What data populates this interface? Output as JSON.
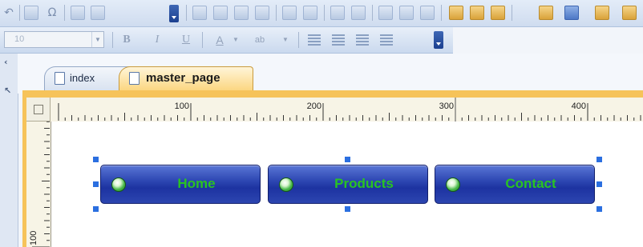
{
  "toolbar2": {
    "font_size_value": "10",
    "bold_label": "B",
    "italic_label": "I",
    "underline_label": "U",
    "font_color_label": "A",
    "highlight_label": "ab"
  },
  "tabs": [
    {
      "label": "index",
      "active": false
    },
    {
      "label": "master_page",
      "active": true
    }
  ],
  "ruler": {
    "horizontal_labels": [
      "100",
      "200",
      "300",
      "400"
    ],
    "vertical_labels": [
      "100"
    ]
  },
  "nav_buttons": [
    {
      "label": "Home",
      "icon": "globe-icon"
    },
    {
      "label": "Products",
      "icon": "globe-icon"
    },
    {
      "label": "Contact",
      "icon": "globe-icon"
    }
  ],
  "colors": {
    "nav_button_fill": "#2338a8",
    "nav_button_text": "#29c322",
    "active_tab": "#fbd57e",
    "selection_handle": "#2b6fe0"
  }
}
